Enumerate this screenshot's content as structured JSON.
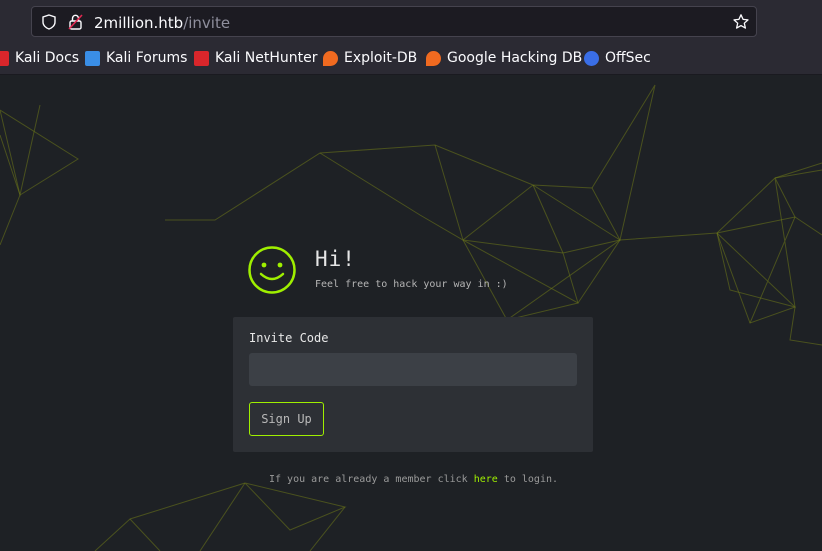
{
  "browser": {
    "url_host": "2million.htb",
    "url_path": "/invite"
  },
  "bookmarks": [
    {
      "label": "Kali Docs",
      "icon": "kali-docs-icon",
      "color": "#d9262b"
    },
    {
      "label": "Kali Forums",
      "icon": "kali-forums-icon",
      "color": "#3a8ee6"
    },
    {
      "label": "Kali NetHunter",
      "icon": "kali-nethunter-icon",
      "color": "#d9262b"
    },
    {
      "label": "Exploit-DB",
      "icon": "exploit-db-icon",
      "color": "#f06a20"
    },
    {
      "label": "Google Hacking DB",
      "icon": "ghdb-icon",
      "color": "#f06a20"
    },
    {
      "label": "OffSec",
      "icon": "offsec-icon",
      "color": "#3a6ee6"
    }
  ],
  "page": {
    "heading": "Hi!",
    "subheading": "Feel free to hack your way in :)",
    "invite_label": "Invite Code",
    "invite_value": "",
    "signup_label": "Sign Up",
    "footer_before": "If you are already a member click ",
    "footer_link": "here",
    "footer_after": " to login."
  },
  "colors": {
    "accent": "#9fef00",
    "background": "#1e2125",
    "card": "#2d3035"
  }
}
